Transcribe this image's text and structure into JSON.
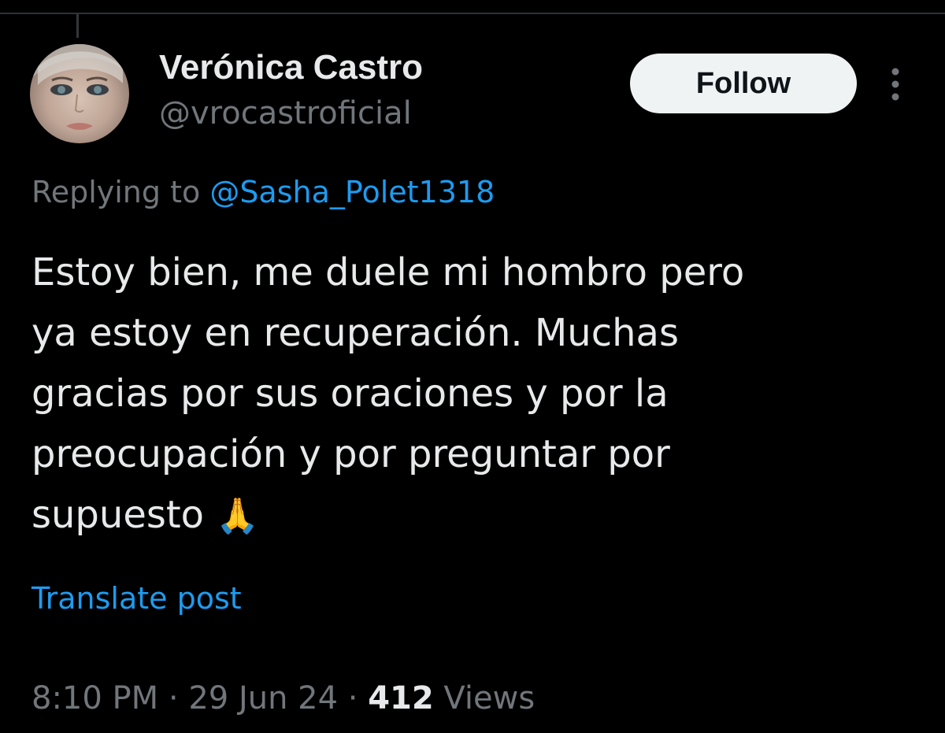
{
  "colors": {
    "background": "#000000",
    "text_primary": "#e7e9ea",
    "text_secondary": "#71767b",
    "accent_link": "#1d9bf0",
    "follow_button_bg": "#eff3f4"
  },
  "author": {
    "display_name": "Verónica Castro",
    "handle": "@vrocastroficial",
    "avatar_icon": "profile-photo"
  },
  "header": {
    "follow_label": "Follow",
    "more_icon": "more-vertical-icon"
  },
  "reply": {
    "prefix": "Replying to ",
    "to_handle": "@Sasha_Polet1318"
  },
  "tweet": {
    "lines": [
      "Estoy bien, me duele mi hombro pero",
      "ya estoy en recuperación. Muchas",
      "gracias por sus oraciones y por la",
      "preocupación y por preguntar por",
      "supuesto"
    ],
    "emoji": "🙏"
  },
  "translate": {
    "label": "Translate post"
  },
  "meta": {
    "time": "8:10 PM",
    "separator": " · ",
    "date": "29 Jun 24",
    "views_count": "412",
    "views_label": " Views"
  }
}
